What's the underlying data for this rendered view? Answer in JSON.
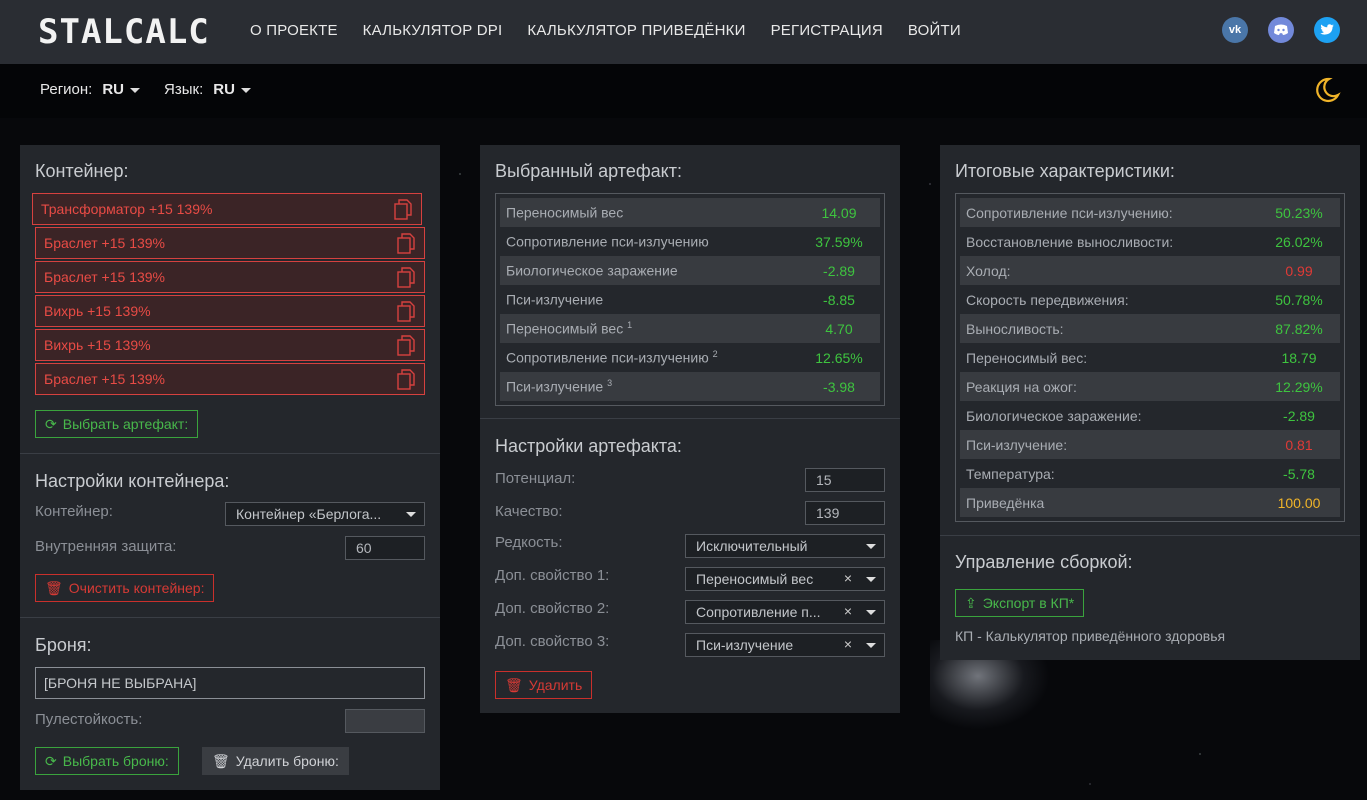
{
  "header": {
    "logo": "STALCALC",
    "nav": [
      "О ПРОЕКТЕ",
      "КАЛЬКУЛЯТОР DPI",
      "КАЛЬКУЛЯТОР ПРИВЕДЁНКИ",
      "РЕГИСТРАЦИЯ",
      "ВОЙТИ"
    ],
    "social": [
      "vk-icon",
      "discord-icon",
      "twitter-icon"
    ],
    "colors": {
      "vk": "#4a76a8",
      "discord": "#7289da",
      "twitter": "#1da1f2"
    }
  },
  "subbar": {
    "region_label": "Регион:",
    "region_value": "RU",
    "lang_label": "Язык:",
    "lang_value": "RU"
  },
  "container": {
    "title": "Контейнер:",
    "items": [
      "Трансформатор +15 139%",
      "Браслет +15 139%",
      "Браслет +15 139%",
      "Вихрь +15 139%",
      "Вихрь +15 139%",
      "Браслет +15 139%"
    ],
    "select_artifact_btn": "Выбрать артефакт:"
  },
  "container_settings": {
    "title": "Настройки контейнера:",
    "container_label": "Контейнер:",
    "container_value": "Контейнер «Берлога...",
    "protection_label": "Внутренняя защита:",
    "protection_value": "60",
    "clear_btn": "Очистить контейнер:"
  },
  "armor": {
    "title": "Броня:",
    "value": "[БРОНЯ НЕ ВЫБРАНА]",
    "bullet_label": "Пулестойкость:",
    "bullet_value": "",
    "select_btn": "Выбрать броню:",
    "delete_btn": "Удалить броню:"
  },
  "selected_artifact": {
    "title": "Выбранный артефакт:",
    "rows": [
      {
        "name": "Переносимый вес",
        "sup": "",
        "value": "14.09",
        "color": "g"
      },
      {
        "name": "Сопротивление пси-излучению",
        "sup": "",
        "value": "37.59%",
        "color": "g"
      },
      {
        "name": "Биологическое заражение",
        "sup": "",
        "value": "-2.89",
        "color": "g"
      },
      {
        "name": "Пси-излучение",
        "sup": "",
        "value": "-8.85",
        "color": "g"
      },
      {
        "name": "Переносимый вес",
        "sup": "1",
        "value": "4.70",
        "color": "g"
      },
      {
        "name": "Сопротивление пси-излучению",
        "sup": "2",
        "value": "12.65%",
        "color": "g"
      },
      {
        "name": "Пси-излучение",
        "sup": "3",
        "value": "-3.98",
        "color": "g"
      }
    ]
  },
  "artifact_settings": {
    "title": "Настройки артефакта:",
    "potential_label": "Потенциал:",
    "potential_value": "15",
    "quality_label": "Качество:",
    "quality_value": "139",
    "rarity_label": "Редкость:",
    "rarity_value": "Исключительный",
    "prop1_label": "Доп. свойство 1:",
    "prop1_value": "Переносимый вес",
    "prop2_label": "Доп. свойство 2:",
    "prop2_value": "Сопротивление п...",
    "prop3_label": "Доп. свойство 3:",
    "prop3_value": "Пси-излучение",
    "clear_symbol": "×",
    "delete_btn": "Удалить"
  },
  "totals": {
    "title": "Итоговые характеристики:",
    "rows": [
      {
        "name": "Сопротивление пси-излучению:",
        "value": "50.23%",
        "color": "g"
      },
      {
        "name": "Восстановление выносливости:",
        "value": "26.02%",
        "color": "g"
      },
      {
        "name": "Холод:",
        "value": "0.99",
        "color": "r"
      },
      {
        "name": "Скорость передвижения:",
        "value": "50.78%",
        "color": "g"
      },
      {
        "name": "Выносливость:",
        "value": "87.82%",
        "color": "g"
      },
      {
        "name": "Переносимый вес:",
        "value": "18.79",
        "color": "g"
      },
      {
        "name": "Реакция на ожог:",
        "value": "12.29%",
        "color": "g"
      },
      {
        "name": "Биологическое заражение:",
        "value": "-2.89",
        "color": "g"
      },
      {
        "name": "Пси-излучение:",
        "value": "0.81",
        "color": "r"
      },
      {
        "name": "Температура:",
        "value": "-5.78",
        "color": "g"
      },
      {
        "name": "Приведёнка",
        "value": "100.00",
        "color": "y"
      }
    ]
  },
  "build": {
    "title": "Управление сборкой:",
    "export_btn": "Экспорт в КП*",
    "note": "КП - Калькулятор приведённого здоровья"
  }
}
